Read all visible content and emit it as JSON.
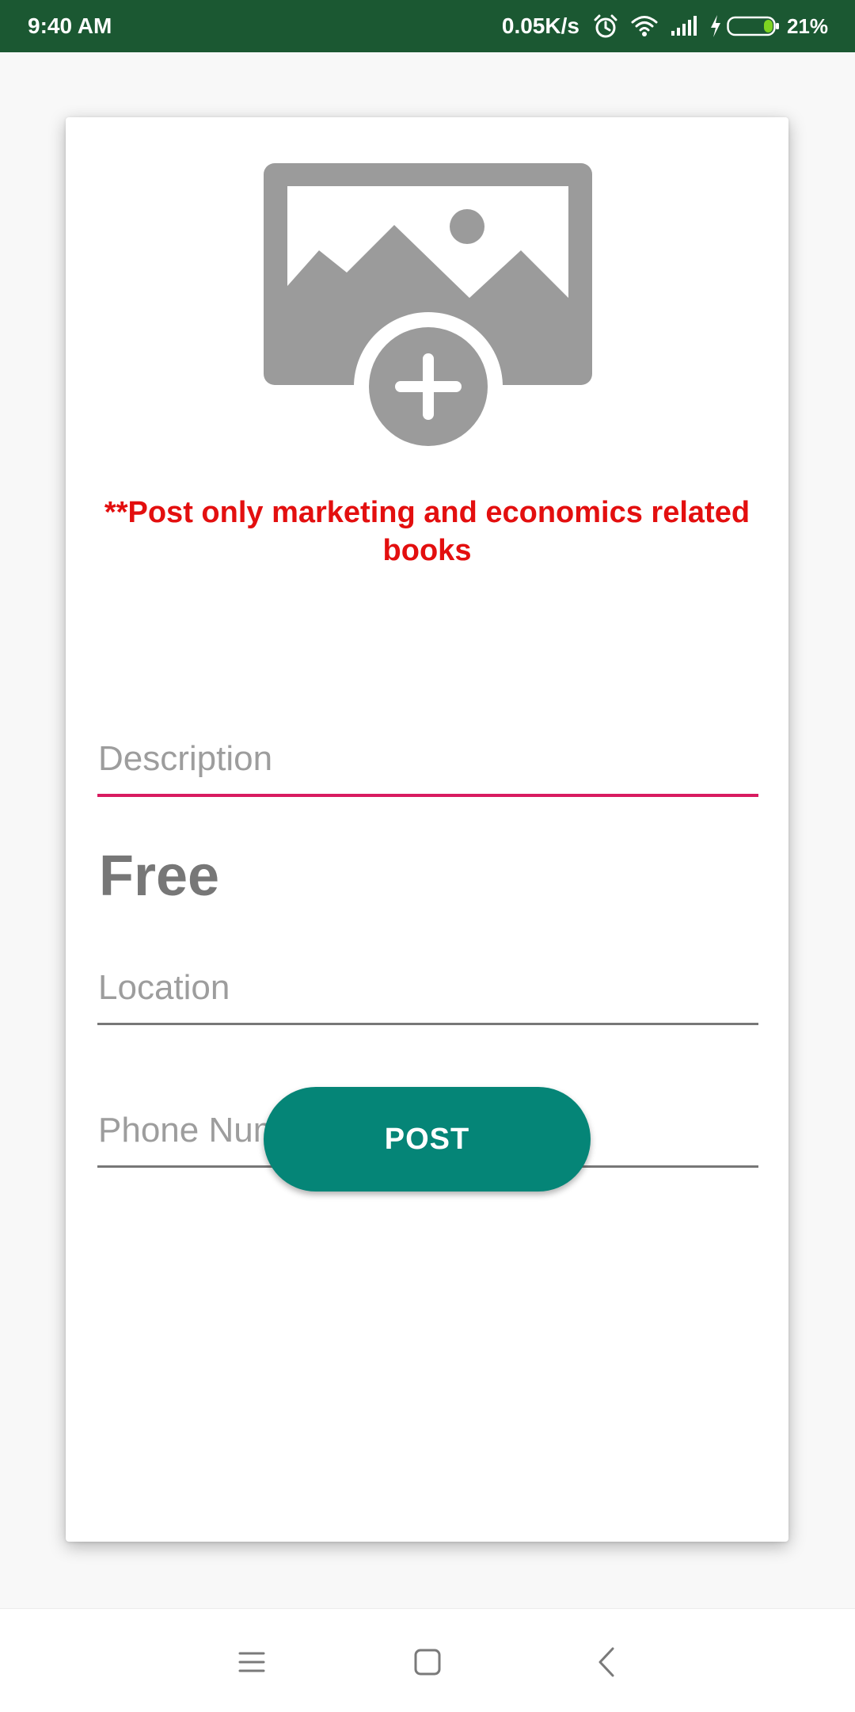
{
  "status_bar": {
    "time": "9:40 AM",
    "net_speed": "0.05K/s",
    "battery_percent": "21%",
    "icons": [
      "alarm-icon",
      "wifi-icon",
      "signal-icon",
      "charging-icon",
      "battery-icon"
    ]
  },
  "form": {
    "image_picker_icon": "add-photo-icon",
    "notice": "**Post only marketing and economics related books",
    "description": {
      "placeholder": "Description",
      "value": ""
    },
    "price": "Free",
    "location": {
      "placeholder": "Location",
      "value": ""
    },
    "phone": {
      "placeholder": "Phone Number",
      "value": ""
    },
    "post_label": "POST"
  },
  "nav_bar": {
    "icons": [
      "menu-icon",
      "home-icon",
      "back-icon"
    ]
  },
  "colors": {
    "status_bar": "#1b5832",
    "notice_text": "#e30f0f",
    "focused_underline": "#d81b60",
    "post_button": "#058577",
    "battery_fill": "#7ed321"
  }
}
